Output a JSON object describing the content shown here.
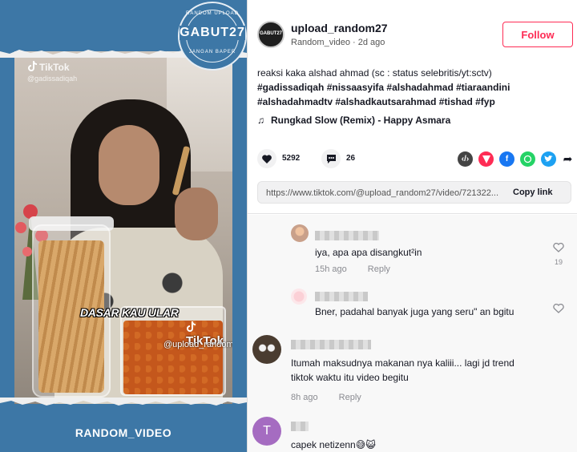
{
  "video": {
    "watermark_brand": "TikTok",
    "watermark_handle_small": "@gadissadiqah",
    "watermark_handle_large": "@upload_random27",
    "caption_overlay": "DASAR KAU ULAR",
    "badge": {
      "title": "GABUT27",
      "top_text": "RANDOM UPLOAD",
      "bottom_text": "JANGAN BAPER"
    },
    "footer_label": "RANDOM_VIDEO",
    "colors": {
      "background": "#3d77a6"
    }
  },
  "post": {
    "avatar_text": "GABUT27",
    "username": "upload_random27",
    "subline": "Random_video · 2d ago",
    "follow_label": "Follow",
    "description_text": "reaksi kaka alshad ahmad (sc : status selebritis/yt:sctv)",
    "hashtags_line1": "#gadissadiqah #nissaasyifa #alshadahmad #tiaraandini",
    "hashtags_line2": "#alshadahmadtv #alshadkautsarahmad #tishad #fyp",
    "music_icon": "music-note-icon",
    "music": "Rungkad Slow (Remix) - Happy Asmara",
    "likes": "5292",
    "comments": "26",
    "link_url": "https://www.tiktok.com/@upload_random27/video/721322...",
    "copy_link_label": "Copy link",
    "colors": {
      "accent": "#fe2c55"
    }
  },
  "comments": [
    {
      "text": "iya, apa apa disangkut²in",
      "time": "15h ago",
      "reply": "Reply",
      "likes": "19"
    },
    {
      "text": "Bner, padahal banyak juga yang seru\" an bgitu",
      "time": "",
      "reply": "",
      "likes": ""
    },
    {
      "text_line1": "Itumah maksudnya makanan nya kaliii... lagi jd trend",
      "text_line2": "tiktok waktu itu video begitu",
      "time": "8h ago",
      "reply": "Reply"
    },
    {
      "avatar_letter": "T",
      "text": "capek netizenn😅😺"
    }
  ]
}
